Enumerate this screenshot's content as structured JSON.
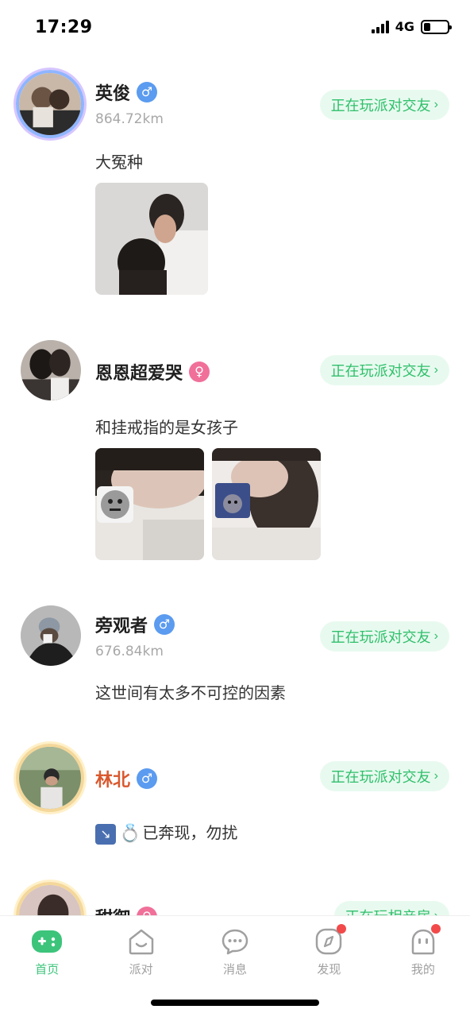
{
  "status_bar": {
    "time": "17:29",
    "network": "4G",
    "battery_level": 0.3
  },
  "party_button_label": "正在玩派对交友",
  "posts": [
    {
      "name": "英俊",
      "gender": "male",
      "gender_symbol": "♂",
      "distance": "864.72km",
      "bio": "大冤种"
    },
    {
      "name": "恩恩超爱哭",
      "gender": "female",
      "gender_symbol": "♀",
      "distance": "",
      "bio": "和挂戒指的是女孩子"
    },
    {
      "name": "旁观者",
      "gender": "male",
      "gender_symbol": "♂",
      "distance": "676.84km",
      "bio": "这世间有太多不可控的因素"
    },
    {
      "name": "林北",
      "gender": "male",
      "gender_symbol": "♂",
      "distance": "",
      "bio": "已奔现，勿扰",
      "bio_emoji_1": "↘",
      "bio_emoji_2": "💍"
    },
    {
      "name": "甜御",
      "gender": "female",
      "gender_symbol": "♀",
      "button_label": "正在玩相亲房"
    }
  ],
  "tabs": [
    {
      "label": "首页",
      "icon": "gamepad-icon",
      "active": true,
      "badge": false
    },
    {
      "label": "派对",
      "icon": "party-house-icon",
      "active": false,
      "badge": false
    },
    {
      "label": "消息",
      "icon": "chat-bubble-icon",
      "active": false,
      "badge": false
    },
    {
      "label": "发现",
      "icon": "compass-icon",
      "active": false,
      "badge": true
    },
    {
      "label": "我的",
      "icon": "profile-face-icon",
      "active": false,
      "badge": true
    }
  ],
  "colors": {
    "accent_green": "#3cc47b",
    "button_bg": "#e8faef",
    "male_blue": "#5b9bf0",
    "female_pink": "#f0709a",
    "badge_red": "#f24a4a",
    "name_orange": "#d9582d"
  }
}
